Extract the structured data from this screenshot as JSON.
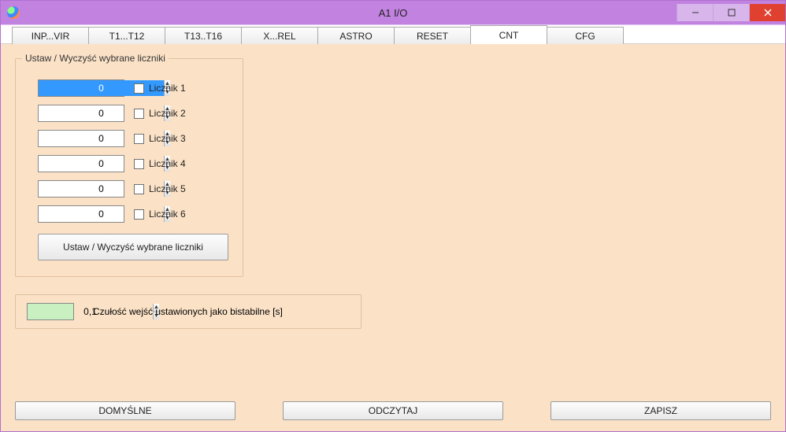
{
  "window": {
    "title": "A1 I/O"
  },
  "tabs": [
    {
      "label": "INP...VIR"
    },
    {
      "label": "T1...T12"
    },
    {
      "label": "T13..T16"
    },
    {
      "label": "X...REL"
    },
    {
      "label": "ASTRO"
    },
    {
      "label": "RESET"
    },
    {
      "label": "CNT",
      "active": true
    },
    {
      "label": "CFG"
    }
  ],
  "group": {
    "legend": "Ustaw / Wyczyść wybrane liczniki",
    "counters": [
      {
        "value": "0",
        "label": "Licznik 1",
        "selected": true
      },
      {
        "value": "0",
        "label": "Licznik 2"
      },
      {
        "value": "0",
        "label": "Licznik 3"
      },
      {
        "value": "0",
        "label": "Licznik 4"
      },
      {
        "value": "0",
        "label": "Licznik 5"
      },
      {
        "value": "0",
        "label": "Licznik 6"
      }
    ],
    "action_label": "Ustaw / Wyczyść wybrane liczniki"
  },
  "sensitivity": {
    "value": "0,1",
    "label": "Czułość wejść ustawionych jako bistabilne [s]"
  },
  "buttons": {
    "default": "DOMYŚLNE",
    "read": "ODCZYTAJ",
    "write": "ZAPISZ"
  }
}
